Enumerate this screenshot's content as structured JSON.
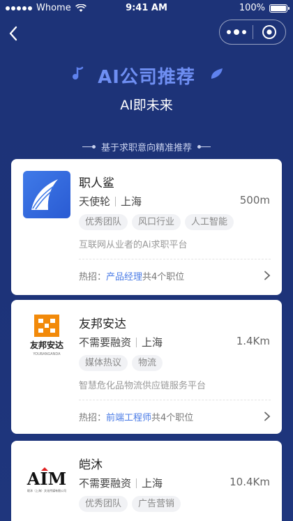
{
  "status_bar": {
    "carrier": "Whome",
    "time": "9:41 AM",
    "battery": "100%"
  },
  "header": {
    "title": "AI公司推荐",
    "subtitle": "AI即未来"
  },
  "section": {
    "label": "基于求职意向精准推荐"
  },
  "cards": [
    {
      "name": "职人鲨",
      "stage": "天使轮",
      "city": "上海",
      "distance": "500m",
      "tags": [
        "优秀团队",
        "风口行业",
        "人工智能"
      ],
      "desc": "互联网从业者的Ai求职平台",
      "hot_label": "热招：",
      "hot_job": "产品经理",
      "hot_suffix": "共4个职位"
    },
    {
      "name": "友邦安达",
      "stage": "不需要融资",
      "city": "上海",
      "distance": "1.4Km",
      "tags": [
        "媒体热议",
        "物流"
      ],
      "desc": "智慧危化品物流供应链服务平台",
      "hot_label": "热招：",
      "hot_job": "前端工程师",
      "hot_suffix": "共4个职位",
      "logo_text": "友邦安达",
      "logo_sub": "YOUBANGANDA"
    },
    {
      "name": "皑沐",
      "stage": "不需要融资",
      "city": "上海",
      "distance": "10.4Km",
      "tags": [
        "优秀团队",
        "广告营销"
      ],
      "logo_text": "AIM",
      "logo_sub": "皑沐（上海）文化传媒有限公司"
    }
  ],
  "colors": {
    "accent": "#4a7be6",
    "background": "#1d3378",
    "title": "#6f8ff3"
  }
}
